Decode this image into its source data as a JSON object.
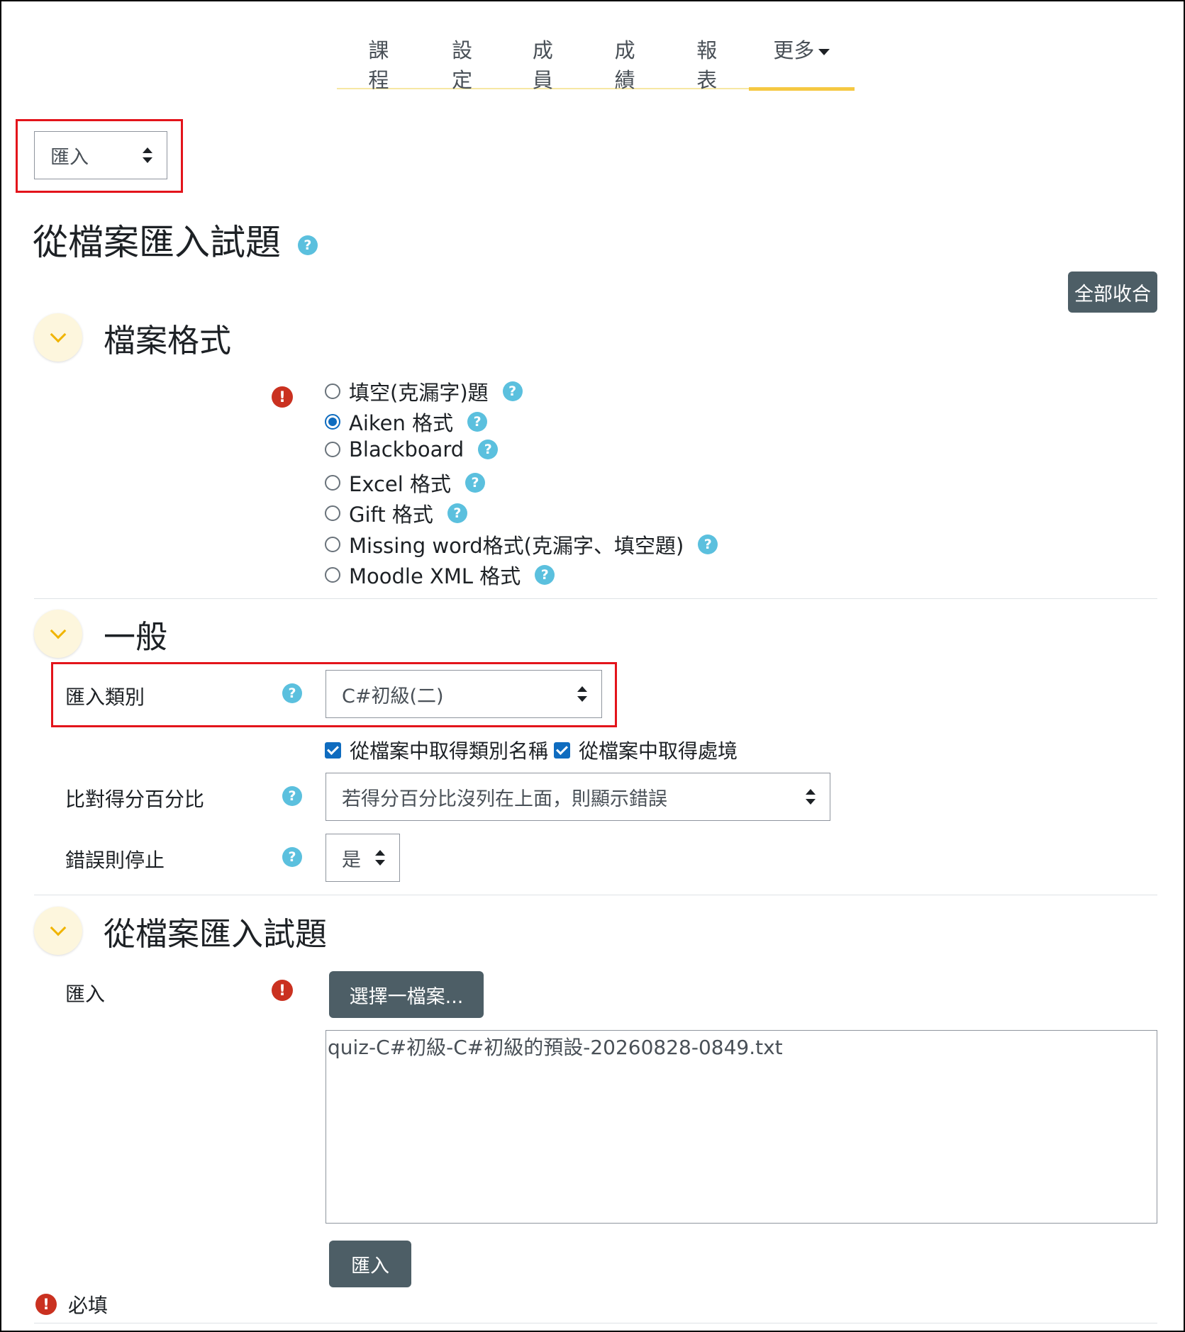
{
  "nav": {
    "items": [
      "課程",
      "設定",
      "成員",
      "成績",
      "報表"
    ],
    "more_label": "更多"
  },
  "action_select": {
    "value": "匯入"
  },
  "page_title": "從檔案匯入試題",
  "collapse_all_label": "全部收合",
  "sections": {
    "file_format": {
      "title": "檔案格式",
      "options": [
        {
          "label": "填空(克漏字)題",
          "checked": false
        },
        {
          "label": "Aiken 格式",
          "checked": true
        },
        {
          "label": "Blackboard",
          "checked": false
        },
        {
          "label": "Excel 格式",
          "checked": false
        },
        {
          "label": "Gift 格式",
          "checked": false
        },
        {
          "label": "Missing word格式(克漏字、填空題)",
          "checked": false
        },
        {
          "label": "Moodle XML 格式",
          "checked": false
        }
      ]
    },
    "general": {
      "title": "一般",
      "import_category_label": "匯入類別",
      "import_category_value": "C#初級(二)",
      "checkbox_category_label": "從檔案中取得類別名稱",
      "checkbox_context_label": "從檔案中取得處境",
      "match_grades_label": "比對得分百分比",
      "match_grades_value": "若得分百分比沒列在上面，則顯示錯誤",
      "stop_on_error_label": "錯誤則停止",
      "stop_on_error_value": "是"
    },
    "import_file": {
      "title": "從檔案匯入試題",
      "import_label": "匯入",
      "choose_file_label": "選擇一檔案...",
      "file_name": "quiz-C#初級-C#初級的預設-20260828-0849.txt",
      "submit_label": "匯入"
    }
  },
  "required_label": "必填",
  "colors": {
    "accent": "#f5c842",
    "highlight": "#e3141b",
    "help": "#5bc0de",
    "error": "#ca3120",
    "button": "#4d5e66",
    "primary": "#0f6cbf"
  }
}
